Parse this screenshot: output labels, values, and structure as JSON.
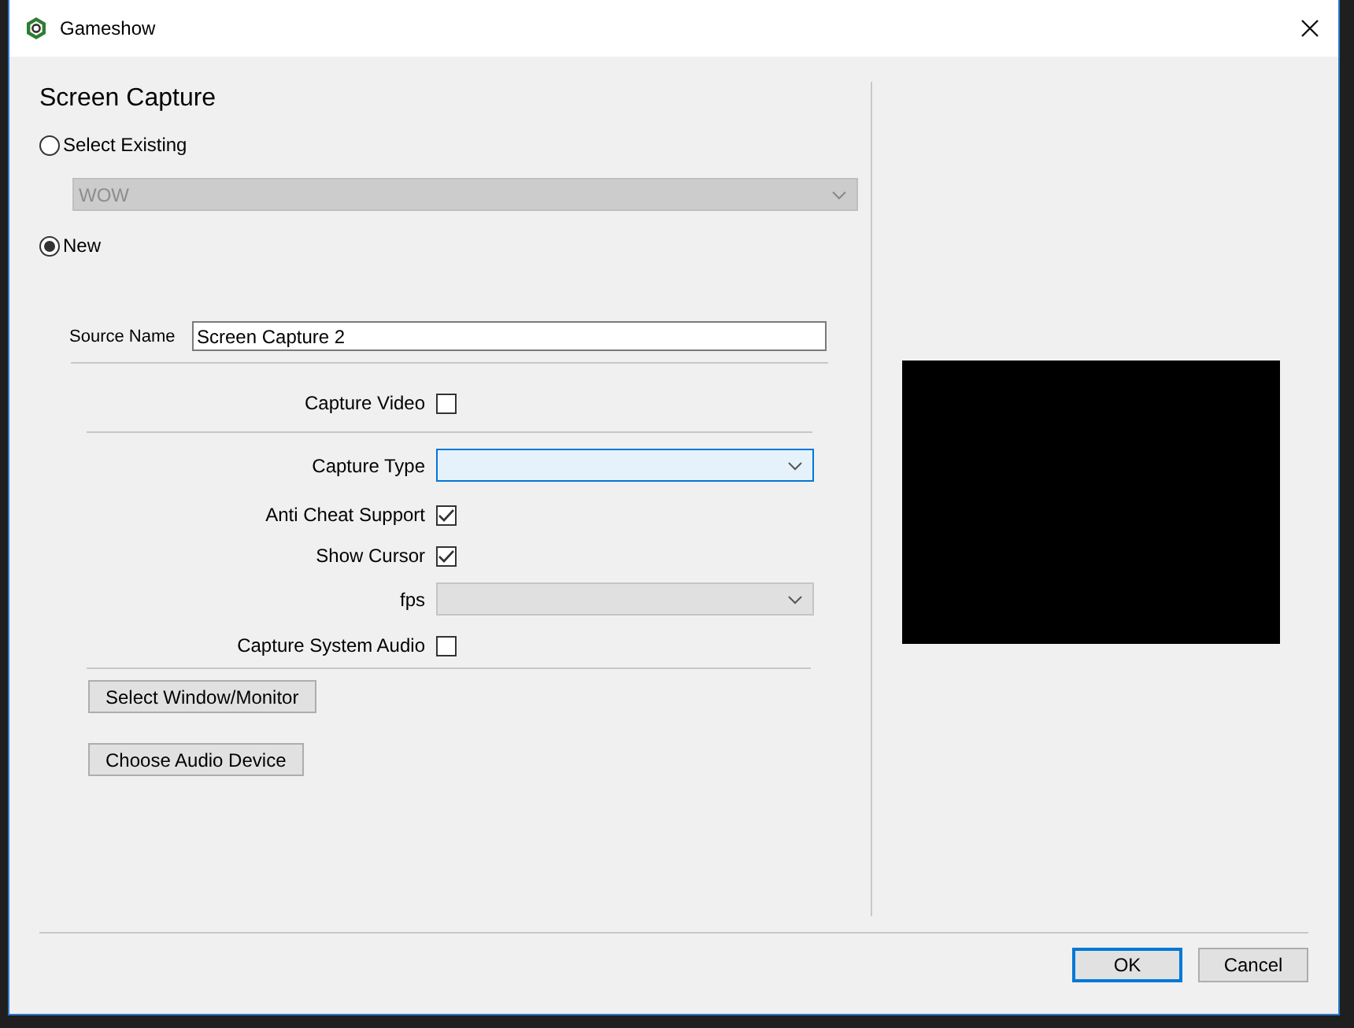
{
  "window": {
    "title": "Gameshow"
  },
  "heading": "Screen Capture",
  "source_options": [
    {
      "label": "Select Existing",
      "selected": false
    },
    {
      "label": "New",
      "selected": true
    }
  ],
  "existing_dropdown": {
    "value": "WOW",
    "disabled": true
  },
  "source_name": {
    "label": "Source Name",
    "value": "Screen Capture 2"
  },
  "capture_video": {
    "label": "Capture Video",
    "checked": false
  },
  "settings": [
    {
      "kind": "select",
      "label": "Capture Type",
      "focused": true,
      "disabled": false
    },
    {
      "kind": "checkbox",
      "label": "Anti Cheat Support",
      "checked": true
    },
    {
      "kind": "checkbox",
      "label": "Show Cursor",
      "checked": true
    },
    {
      "kind": "select",
      "label": "fps",
      "focused": false,
      "disabled": true
    },
    {
      "kind": "checkbox",
      "label": "Capture System Audio",
      "checked": false
    }
  ],
  "actions": [
    "Select Window/Monitor",
    "Choose Audio Device"
  ],
  "buttons": [
    {
      "label": "OK",
      "default": true
    },
    {
      "label": "Cancel",
      "default": false
    }
  ]
}
